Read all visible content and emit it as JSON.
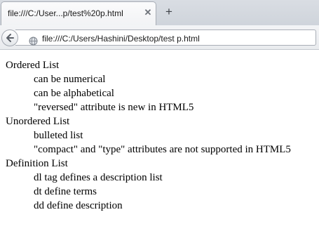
{
  "browser": {
    "tab_title": "file:///C:/User...p/test%20p.html",
    "tab_close_glyph": "✕",
    "new_tab_glyph": "+",
    "address": "file:///C:/Users/Hashini/Desktop/test p.html"
  },
  "page": {
    "sections": [
      {
        "heading": "Ordered List",
        "items": [
          "can be numerical",
          "can be alphabetical",
          "\"reversed\" attribute is new in HTML5"
        ]
      },
      {
        "heading": "Unordered List",
        "items": [
          "bulleted list",
          "\"compact\" and \"type\" attributes are not supported in HTML5"
        ]
      },
      {
        "heading": "Definition List",
        "items": [
          "dl tag defines a description list",
          "dt define terms",
          "dd define description"
        ]
      }
    ]
  }
}
